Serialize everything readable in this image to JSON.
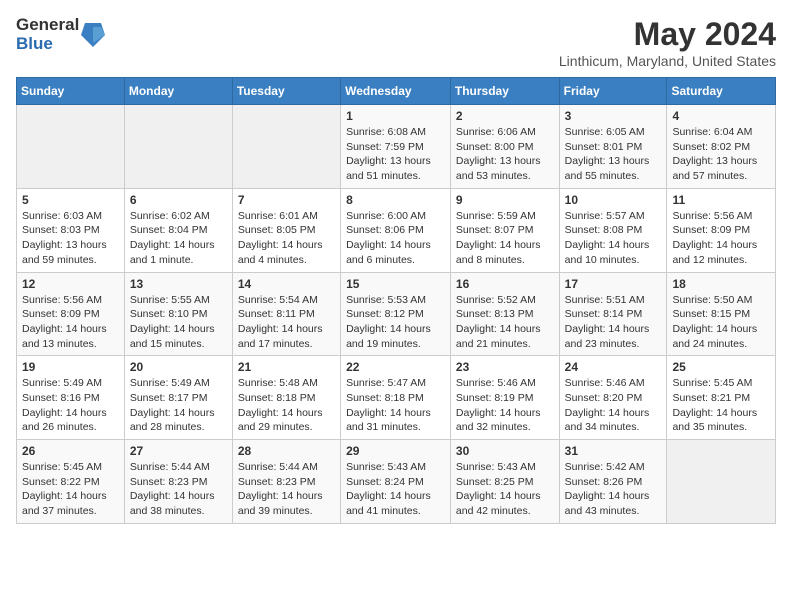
{
  "logo": {
    "general": "General",
    "blue": "Blue"
  },
  "title": "May 2024",
  "location": "Linthicum, Maryland, United States",
  "weekdays": [
    "Sunday",
    "Monday",
    "Tuesday",
    "Wednesday",
    "Thursday",
    "Friday",
    "Saturday"
  ],
  "weeks": [
    [
      {
        "day": "",
        "sunrise": "",
        "sunset": "",
        "daylight": ""
      },
      {
        "day": "",
        "sunrise": "",
        "sunset": "",
        "daylight": ""
      },
      {
        "day": "",
        "sunrise": "",
        "sunset": "",
        "daylight": ""
      },
      {
        "day": "1",
        "sunrise": "Sunrise: 6:08 AM",
        "sunset": "Sunset: 7:59 PM",
        "daylight": "Daylight: 13 hours and 51 minutes."
      },
      {
        "day": "2",
        "sunrise": "Sunrise: 6:06 AM",
        "sunset": "Sunset: 8:00 PM",
        "daylight": "Daylight: 13 hours and 53 minutes."
      },
      {
        "day": "3",
        "sunrise": "Sunrise: 6:05 AM",
        "sunset": "Sunset: 8:01 PM",
        "daylight": "Daylight: 13 hours and 55 minutes."
      },
      {
        "day": "4",
        "sunrise": "Sunrise: 6:04 AM",
        "sunset": "Sunset: 8:02 PM",
        "daylight": "Daylight: 13 hours and 57 minutes."
      }
    ],
    [
      {
        "day": "5",
        "sunrise": "Sunrise: 6:03 AM",
        "sunset": "Sunset: 8:03 PM",
        "daylight": "Daylight: 13 hours and 59 minutes."
      },
      {
        "day": "6",
        "sunrise": "Sunrise: 6:02 AM",
        "sunset": "Sunset: 8:04 PM",
        "daylight": "Daylight: 14 hours and 1 minute."
      },
      {
        "day": "7",
        "sunrise": "Sunrise: 6:01 AM",
        "sunset": "Sunset: 8:05 PM",
        "daylight": "Daylight: 14 hours and 4 minutes."
      },
      {
        "day": "8",
        "sunrise": "Sunrise: 6:00 AM",
        "sunset": "Sunset: 8:06 PM",
        "daylight": "Daylight: 14 hours and 6 minutes."
      },
      {
        "day": "9",
        "sunrise": "Sunrise: 5:59 AM",
        "sunset": "Sunset: 8:07 PM",
        "daylight": "Daylight: 14 hours and 8 minutes."
      },
      {
        "day": "10",
        "sunrise": "Sunrise: 5:57 AM",
        "sunset": "Sunset: 8:08 PM",
        "daylight": "Daylight: 14 hours and 10 minutes."
      },
      {
        "day": "11",
        "sunrise": "Sunrise: 5:56 AM",
        "sunset": "Sunset: 8:09 PM",
        "daylight": "Daylight: 14 hours and 12 minutes."
      }
    ],
    [
      {
        "day": "12",
        "sunrise": "Sunrise: 5:56 AM",
        "sunset": "Sunset: 8:09 PM",
        "daylight": "Daylight: 14 hours and 13 minutes."
      },
      {
        "day": "13",
        "sunrise": "Sunrise: 5:55 AM",
        "sunset": "Sunset: 8:10 PM",
        "daylight": "Daylight: 14 hours and 15 minutes."
      },
      {
        "day": "14",
        "sunrise": "Sunrise: 5:54 AM",
        "sunset": "Sunset: 8:11 PM",
        "daylight": "Daylight: 14 hours and 17 minutes."
      },
      {
        "day": "15",
        "sunrise": "Sunrise: 5:53 AM",
        "sunset": "Sunset: 8:12 PM",
        "daylight": "Daylight: 14 hours and 19 minutes."
      },
      {
        "day": "16",
        "sunrise": "Sunrise: 5:52 AM",
        "sunset": "Sunset: 8:13 PM",
        "daylight": "Daylight: 14 hours and 21 minutes."
      },
      {
        "day": "17",
        "sunrise": "Sunrise: 5:51 AM",
        "sunset": "Sunset: 8:14 PM",
        "daylight": "Daylight: 14 hours and 23 minutes."
      },
      {
        "day": "18",
        "sunrise": "Sunrise: 5:50 AM",
        "sunset": "Sunset: 8:15 PM",
        "daylight": "Daylight: 14 hours and 24 minutes."
      }
    ],
    [
      {
        "day": "19",
        "sunrise": "Sunrise: 5:49 AM",
        "sunset": "Sunset: 8:16 PM",
        "daylight": "Daylight: 14 hours and 26 minutes."
      },
      {
        "day": "20",
        "sunrise": "Sunrise: 5:49 AM",
        "sunset": "Sunset: 8:17 PM",
        "daylight": "Daylight: 14 hours and 28 minutes."
      },
      {
        "day": "21",
        "sunrise": "Sunrise: 5:48 AM",
        "sunset": "Sunset: 8:18 PM",
        "daylight": "Daylight: 14 hours and 29 minutes."
      },
      {
        "day": "22",
        "sunrise": "Sunrise: 5:47 AM",
        "sunset": "Sunset: 8:18 PM",
        "daylight": "Daylight: 14 hours and 31 minutes."
      },
      {
        "day": "23",
        "sunrise": "Sunrise: 5:46 AM",
        "sunset": "Sunset: 8:19 PM",
        "daylight": "Daylight: 14 hours and 32 minutes."
      },
      {
        "day": "24",
        "sunrise": "Sunrise: 5:46 AM",
        "sunset": "Sunset: 8:20 PM",
        "daylight": "Daylight: 14 hours and 34 minutes."
      },
      {
        "day": "25",
        "sunrise": "Sunrise: 5:45 AM",
        "sunset": "Sunset: 8:21 PM",
        "daylight": "Daylight: 14 hours and 35 minutes."
      }
    ],
    [
      {
        "day": "26",
        "sunrise": "Sunrise: 5:45 AM",
        "sunset": "Sunset: 8:22 PM",
        "daylight": "Daylight: 14 hours and 37 minutes."
      },
      {
        "day": "27",
        "sunrise": "Sunrise: 5:44 AM",
        "sunset": "Sunset: 8:23 PM",
        "daylight": "Daylight: 14 hours and 38 minutes."
      },
      {
        "day": "28",
        "sunrise": "Sunrise: 5:44 AM",
        "sunset": "Sunset: 8:23 PM",
        "daylight": "Daylight: 14 hours and 39 minutes."
      },
      {
        "day": "29",
        "sunrise": "Sunrise: 5:43 AM",
        "sunset": "Sunset: 8:24 PM",
        "daylight": "Daylight: 14 hours and 41 minutes."
      },
      {
        "day": "30",
        "sunrise": "Sunrise: 5:43 AM",
        "sunset": "Sunset: 8:25 PM",
        "daylight": "Daylight: 14 hours and 42 minutes."
      },
      {
        "day": "31",
        "sunrise": "Sunrise: 5:42 AM",
        "sunset": "Sunset: 8:26 PM",
        "daylight": "Daylight: 14 hours and 43 minutes."
      },
      {
        "day": "",
        "sunrise": "",
        "sunset": "",
        "daylight": ""
      }
    ]
  ]
}
